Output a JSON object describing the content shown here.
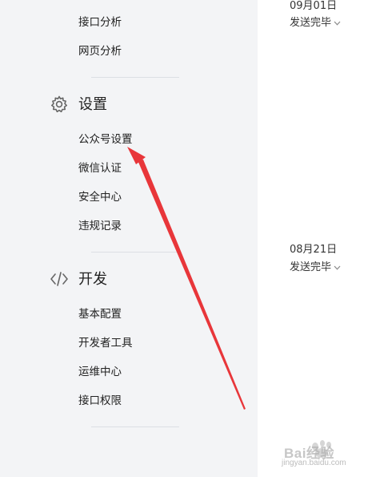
{
  "sidebar": {
    "analytics_items": [
      {
        "label": "接口分析"
      },
      {
        "label": "网页分析"
      }
    ],
    "settings_section": {
      "icon": "gear-icon",
      "title": "设置",
      "items": [
        {
          "label": "公众号设置"
        },
        {
          "label": "微信认证"
        },
        {
          "label": "安全中心"
        },
        {
          "label": "违规记录"
        }
      ]
    },
    "dev_section": {
      "icon": "code-icon",
      "title": "开发",
      "items": [
        {
          "label": "基本配置"
        },
        {
          "label": "开发者工具"
        },
        {
          "label": "运维中心"
        },
        {
          "label": "接口权限"
        }
      ]
    }
  },
  "messages": [
    {
      "date": "09月01日",
      "status": "发送完毕"
    },
    {
      "date": "08月21日",
      "status": "发送完毕"
    }
  ],
  "annotation": {
    "arrow_color": "#e8363a"
  },
  "watermark": {
    "brand": "Bai经验",
    "url": "jingyan.baidu.com"
  }
}
